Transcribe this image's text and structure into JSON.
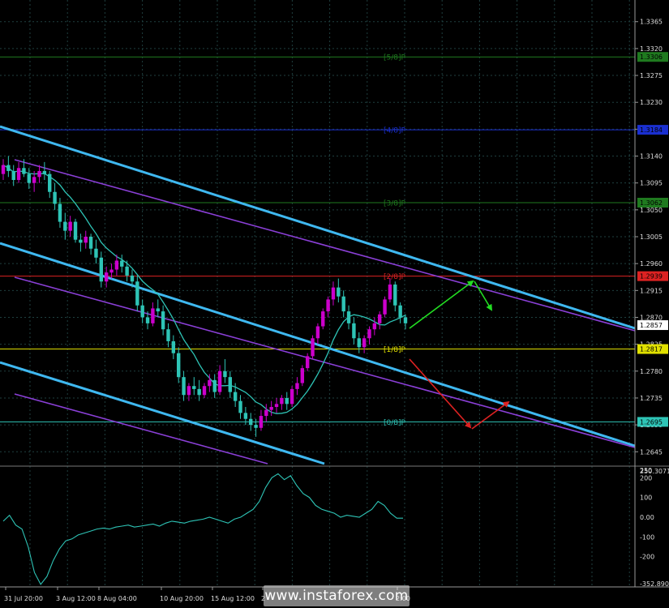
{
  "watermark": "www.instaforex.com",
  "colors": {
    "background": "#000000",
    "grid": "#1f3f3f",
    "bull_candle": "#cc00cc",
    "bear_candle": "#2ec4b6",
    "moving_average": "#2ec4b6",
    "channel_main": "#3fb8f0",
    "channel_inner": "#8a3fd6",
    "forecast_up": "#22dd22",
    "forecast_down": "#dd2222",
    "cci_line": "#2ec4b6"
  },
  "chart_data": [
    {
      "type": "candlestick",
      "ylim": [
        1.2625,
        1.3385
      ],
      "price_ticks": [
        "1.3365",
        "1.3320",
        "1.3275",
        "1.3230",
        "1.3185",
        "1.3140",
        "1.3095",
        "1.3050",
        "1.3005",
        "1.2960",
        "1.2915",
        "1.2870",
        "1.2825",
        "1.2780",
        "1.2735",
        "1.2690",
        "1.2645"
      ],
      "time_ticks": [
        "31 Jul 20:00",
        "3 Aug 12:00",
        "8 Aug 04:00",
        "10 Aug 20:00",
        "15 Aug 12:00",
        "2",
        "2:00"
      ],
      "current_price": {
        "value": 1.2857,
        "label": "1.2857"
      },
      "murrey_levels": [
        {
          "label": "[5/8]P",
          "value": 1.3306,
          "price_label": "1.3306",
          "color": "#1f7a1f"
        },
        {
          "label": "[4/8]P",
          "value": 1.3184,
          "price_label": "1.3184",
          "color": "#1a2fd0"
        },
        {
          "label": "[3/8]P",
          "value": 1.3062,
          "price_label": "1.3062",
          "color": "#1f7a1f"
        },
        {
          "label": "[2/8]P",
          "value": 1.2939,
          "price_label": "1.2939",
          "color": "#dd2222"
        },
        {
          "label": "[1/8]P",
          "value": 1.2817,
          "price_label": "1.2817",
          "color": "#e0e000"
        },
        {
          "label": "[0/8]P",
          "value": 1.2695,
          "price_label": "1.2695",
          "color": "#2ec4b6"
        }
      ],
      "candles": [
        [
          1.311,
          1.3135,
          1.31,
          1.3125
        ],
        [
          1.3125,
          1.314,
          1.3105,
          1.3115
        ],
        [
          1.3115,
          1.3125,
          1.309,
          1.31
        ],
        [
          1.31,
          1.313,
          1.3095,
          1.312
        ],
        [
          1.312,
          1.3135,
          1.3105,
          1.311
        ],
        [
          1.311,
          1.312,
          1.3085,
          1.3095
        ],
        [
          1.3095,
          1.3115,
          1.308,
          1.3105
        ],
        [
          1.3105,
          1.3125,
          1.3095,
          1.3115
        ],
        [
          1.3115,
          1.313,
          1.31,
          1.311
        ],
        [
          1.311,
          1.3115,
          1.307,
          1.308
        ],
        [
          1.308,
          1.3095,
          1.305,
          1.306
        ],
        [
          1.306,
          1.307,
          1.302,
          1.303
        ],
        [
          1.303,
          1.3045,
          1.3,
          1.3015
        ],
        [
          1.3015,
          1.304,
          1.3005,
          1.303
        ],
        [
          1.303,
          1.3035,
          1.2995,
          1.3
        ],
        [
          1.3,
          1.301,
          1.298,
          1.2995
        ],
        [
          1.2995,
          1.3015,
          1.2985,
          1.3005
        ],
        [
          1.3005,
          1.301,
          1.2975,
          1.2985
        ],
        [
          1.2985,
          1.3,
          1.296,
          1.297
        ],
        [
          1.297,
          1.298,
          1.292,
          1.293
        ],
        [
          1.293,
          1.2955,
          1.292,
          1.2945
        ],
        [
          1.2945,
          1.296,
          1.2935,
          1.295
        ],
        [
          1.295,
          1.2975,
          1.294,
          1.2965
        ],
        [
          1.2965,
          1.2975,
          1.2945,
          1.2955
        ],
        [
          1.2955,
          1.2965,
          1.293,
          1.294
        ],
        [
          1.294,
          1.295,
          1.292,
          1.293
        ],
        [
          1.293,
          1.294,
          1.288,
          1.289
        ],
        [
          1.289,
          1.29,
          1.286,
          1.287
        ],
        [
          1.287,
          1.288,
          1.285,
          1.286
        ],
        [
          1.286,
          1.2895,
          1.2855,
          1.2885
        ],
        [
          1.2885,
          1.29,
          1.287,
          1.288
        ],
        [
          1.288,
          1.289,
          1.284,
          1.285
        ],
        [
          1.285,
          1.286,
          1.282,
          1.283
        ],
        [
          1.283,
          1.284,
          1.28,
          1.281
        ],
        [
          1.281,
          1.282,
          1.276,
          1.277
        ],
        [
          1.277,
          1.278,
          1.273,
          1.274
        ],
        [
          1.274,
          1.276,
          1.273,
          1.2755
        ],
        [
          1.2755,
          1.277,
          1.274,
          1.275
        ],
        [
          1.275,
          1.2765,
          1.273,
          1.274
        ],
        [
          1.274,
          1.276,
          1.2735,
          1.2755
        ],
        [
          1.2755,
          1.2775,
          1.2745,
          1.2765
        ],
        [
          1.2765,
          1.2775,
          1.2735,
          1.2745
        ],
        [
          1.2745,
          1.279,
          1.274,
          1.278
        ],
        [
          1.278,
          1.28,
          1.276,
          1.277
        ],
        [
          1.277,
          1.278,
          1.2735,
          1.2745
        ],
        [
          1.2745,
          1.276,
          1.272,
          1.273
        ],
        [
          1.273,
          1.274,
          1.27,
          1.271
        ],
        [
          1.271,
          1.272,
          1.269,
          1.27
        ],
        [
          1.27,
          1.271,
          1.268,
          1.269
        ],
        [
          1.269,
          1.27,
          1.267,
          1.2685
        ],
        [
          1.2685,
          1.2715,
          1.268,
          1.2705
        ],
        [
          1.2705,
          1.2725,
          1.2695,
          1.2715
        ],
        [
          1.2715,
          1.273,
          1.2705,
          1.272
        ],
        [
          1.272,
          1.2735,
          1.271,
          1.2725
        ],
        [
          1.2725,
          1.274,
          1.2715,
          1.2735
        ],
        [
          1.2735,
          1.2745,
          1.2715,
          1.2725
        ],
        [
          1.2725,
          1.2755,
          1.272,
          1.275
        ],
        [
          1.275,
          1.277,
          1.274,
          1.276
        ],
        [
          1.276,
          1.279,
          1.2755,
          1.2785
        ],
        [
          1.2785,
          1.281,
          1.278,
          1.2805
        ],
        [
          1.2805,
          1.284,
          1.28,
          1.2835
        ],
        [
          1.2835,
          1.286,
          1.2825,
          1.2855
        ],
        [
          1.2855,
          1.2885,
          1.285,
          1.288
        ],
        [
          1.288,
          1.2905,
          1.287,
          1.29
        ],
        [
          1.29,
          1.293,
          1.289,
          1.292
        ],
        [
          1.292,
          1.2935,
          1.2895,
          1.2905
        ],
        [
          1.2905,
          1.2915,
          1.287,
          1.288
        ],
        [
          1.288,
          1.289,
          1.285,
          1.286
        ],
        [
          1.286,
          1.287,
          1.2825,
          1.2835
        ],
        [
          1.2835,
          1.2845,
          1.281,
          1.282
        ],
        [
          1.282,
          1.284,
          1.281,
          1.2835
        ],
        [
          1.2835,
          1.2855,
          1.2825,
          1.285
        ],
        [
          1.285,
          1.287,
          1.284,
          1.286
        ],
        [
          1.286,
          1.288,
          1.285,
          1.2875
        ],
        [
          1.2875,
          1.2905,
          1.287,
          1.29
        ],
        [
          1.29,
          1.2935,
          1.2895,
          1.2925
        ],
        [
          1.2925,
          1.293,
          1.288,
          1.289
        ],
        [
          1.289,
          1.2895,
          1.286,
          1.287
        ],
        [
          1.287,
          1.2875,
          1.285,
          1.286
        ]
      ]
    },
    {
      "type": "line",
      "indicator_value": "250.3071",
      "ticks": [
        "250",
        "200",
        "100",
        "0.00",
        "-100",
        "-200",
        "-352.890"
      ],
      "ylim": [
        -352.89,
        250.3071
      ],
      "values": [
        -20,
        10,
        -40,
        -60,
        -150,
        -280,
        -340,
        -300,
        -220,
        -160,
        -120,
        -110,
        -90,
        -80,
        -70,
        -60,
        -55,
        -60,
        -50,
        -45,
        -40,
        -50,
        -45,
        -40,
        -35,
        -45,
        -30,
        -20,
        -25,
        -30,
        -20,
        -15,
        -10,
        0,
        -10,
        -20,
        -30,
        -10,
        0,
        20,
        40,
        80,
        150,
        200,
        220,
        190,
        210,
        160,
        120,
        100,
        60,
        40,
        30,
        20,
        0,
        10,
        5,
        0,
        20,
        40,
        80,
        60,
        20,
        -5,
        -5
      ]
    }
  ]
}
